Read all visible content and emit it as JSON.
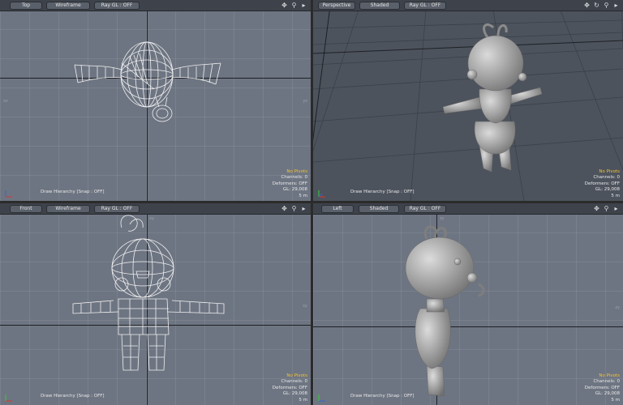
{
  "viewports": {
    "top": {
      "view_label": "Top",
      "shading_label": "Wireframe",
      "raygl_label": "Ray GL : OFF",
      "edge_labels": [
        "xz",
        "yz"
      ],
      "status": {
        "draw_hierarchy": "Draw Hierarchy  [Snap : OFF]",
        "pivots": "No Pivots",
        "channels": "Channels: 0",
        "deformers": "Deformers: OFF",
        "gl": "GL: 29,008",
        "scale": "5 m"
      }
    },
    "perspective": {
      "view_label": "Perspective",
      "shading_label": "Shaded",
      "raygl_label": "Ray GL : OFF",
      "status": {
        "draw_hierarchy": "Draw Hierarchy  [Snap : OFF]",
        "pivots": "No Pivots",
        "channels": "Channels: 0",
        "deformers": "Deformers: OFF",
        "gl": "GL: 29,008",
        "scale": "5 m"
      }
    },
    "front": {
      "view_label": "Front",
      "shading_label": "Wireframe",
      "raygl_label": "Ray GL : OFF",
      "edge_labels": [
        "xy",
        "xy"
      ],
      "status": {
        "draw_hierarchy": "Draw Hierarchy  [Snap : OFF]",
        "pivots": "No Pivots",
        "channels": "Channels: 0",
        "deformers": "Deformers: OFF",
        "gl": "GL: 29,008",
        "scale": "5 m"
      }
    },
    "left": {
      "view_label": "Left",
      "shading_label": "Shaded",
      "raygl_label": "Ray GL : OFF",
      "edge_labels": [
        "zy",
        "zy"
      ],
      "status": {
        "draw_hierarchy": "Draw Hierarchy  [Snap : OFF]",
        "pivots": "No Pivots",
        "channels": "Channels: 0",
        "deformers": "Deformers: OFF",
        "gl": "GL: 29,008",
        "scale": "5 m"
      }
    }
  },
  "icons": {
    "move": "move-view-icon",
    "rotate": "rotate-view-icon",
    "zoom": "zoom-view-icon",
    "menu": "viewport-menu-icon"
  },
  "colors": {
    "ortho_bg": "#6e7582",
    "persp_bg": "#4d535d",
    "header_bg": "#3e434b",
    "pivots": "#f2c232"
  }
}
